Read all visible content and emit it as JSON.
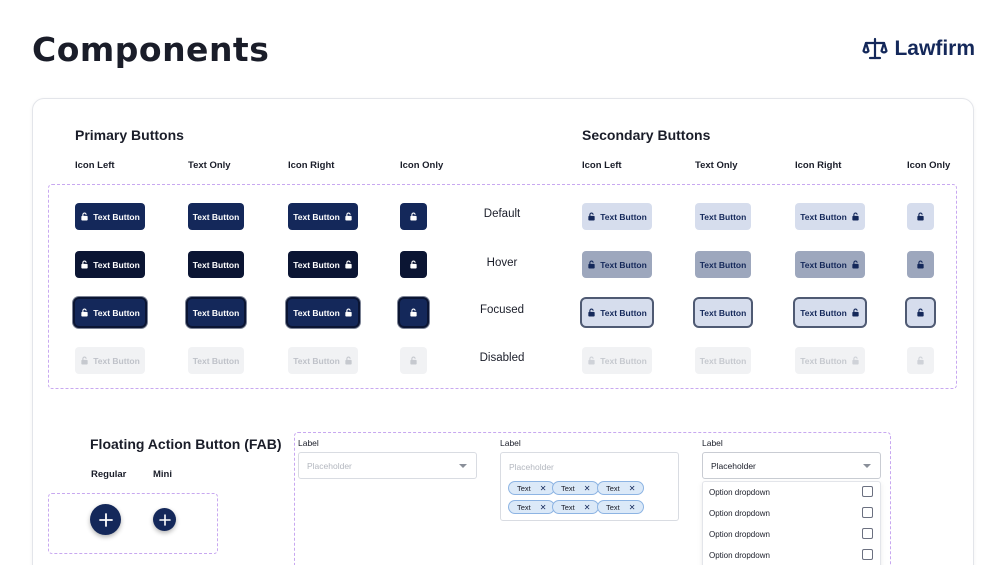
{
  "page": {
    "title": "Components"
  },
  "brand": {
    "name": "Lawfirm",
    "color": "#14285a",
    "icon": "scales-icon"
  },
  "primary": {
    "title": "Primary Buttons",
    "color": "#14285a"
  },
  "secondary": {
    "title": "Secondary Buttons",
    "color": "#d6dded"
  },
  "columns": [
    "Icon Left",
    "Text Only",
    "Icon Right",
    "Icon Only"
  ],
  "button_text": "Text Button",
  "button_icon": "lock-icon",
  "states": [
    "Default",
    "Hover",
    "Focused",
    "Disabled"
  ],
  "fab": {
    "title": "Floating Action Button (FAB)",
    "regular_label": "Regular",
    "mini_label": "Mini",
    "icon": "plus-icon"
  },
  "selects": [
    {
      "label": "Label",
      "placeholder": "Placeholder"
    },
    {
      "label": "Label",
      "placeholder": "Placeholder",
      "chips": [
        "Text",
        "Text",
        "Text",
        "Text",
        "Text",
        "Text"
      ]
    },
    {
      "label": "Label",
      "placeholder": "Placeholder",
      "options": [
        "Option dropdown",
        "Option dropdown",
        "Option dropdown",
        "Option dropdown"
      ]
    }
  ]
}
